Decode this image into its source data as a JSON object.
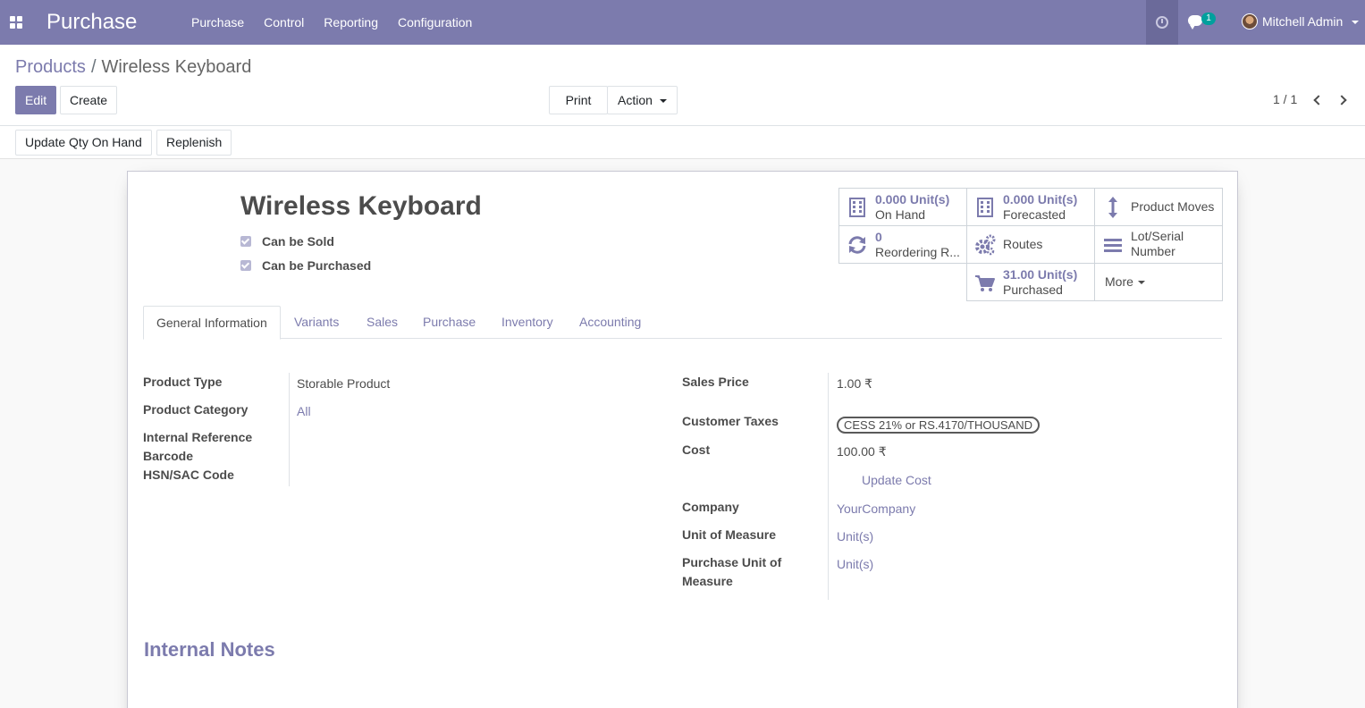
{
  "navbar": {
    "app_name": "Purchase",
    "menu": [
      "Purchase",
      "Control",
      "Reporting",
      "Configuration"
    ],
    "chat_count": "1",
    "user_name": "Mitchell Admin",
    "accent_color": "#7c7bad"
  },
  "breadcrumb": {
    "parent": "Products",
    "separator": "/",
    "current": "Wireless Keyboard"
  },
  "control": {
    "edit_label": "Edit",
    "create_label": "Create",
    "print_label": "Print",
    "action_label": "Action",
    "pager": "1 / 1"
  },
  "statusbar": {
    "update_qty_label": "Update Qty On Hand",
    "replenish_label": "Replenish"
  },
  "product": {
    "name": "Wireless Keyboard",
    "can_be_sold_label": "Can be Sold",
    "can_be_purchased_label": "Can be Purchased",
    "can_be_sold": true,
    "can_be_purchased": true
  },
  "smart_buttons": {
    "on_hand_value": "0.000 Unit(s)",
    "on_hand_label": "On Hand",
    "forecasted_value": "0.000 Unit(s)",
    "forecasted_label": "Forecasted",
    "product_moves_label": "Product Moves",
    "reordering_value": "0",
    "reordering_label": "Reordering R...",
    "routes_label": "Routes",
    "lot_serial_line1": "Lot/Serial",
    "lot_serial_line2": "Number",
    "purchased_value": "31.00 Unit(s)",
    "purchased_label": "Purchased",
    "more_label": "More"
  },
  "tabs": [
    "General Information",
    "Variants",
    "Sales",
    "Purchase",
    "Inventory",
    "Accounting"
  ],
  "general": {
    "product_type_label": "Product Type",
    "product_type_value": "Storable Product",
    "product_category_label": "Product Category",
    "product_category_value": "All",
    "internal_reference_label": "Internal Reference",
    "barcode_label": "Barcode",
    "hsn_label": "HSN/SAC Code",
    "sales_price_label": "Sales Price",
    "sales_price_value": "1.00 ₹",
    "customer_taxes_label": "Customer Taxes",
    "customer_taxes_value": "CESS 21% or RS.4170/THOUSAND",
    "cost_label": "Cost",
    "cost_value": "100.00 ₹",
    "update_cost_label": "Update Cost",
    "company_label": "Company",
    "company_value": "YourCompany",
    "uom_label": "Unit of Measure",
    "uom_value": "Unit(s)",
    "purchase_uom_label_line1": "Purchase Unit of",
    "purchase_uom_label_line2": "Measure",
    "purchase_uom_value": "Unit(s)"
  },
  "notes": {
    "title": "Internal Notes"
  }
}
